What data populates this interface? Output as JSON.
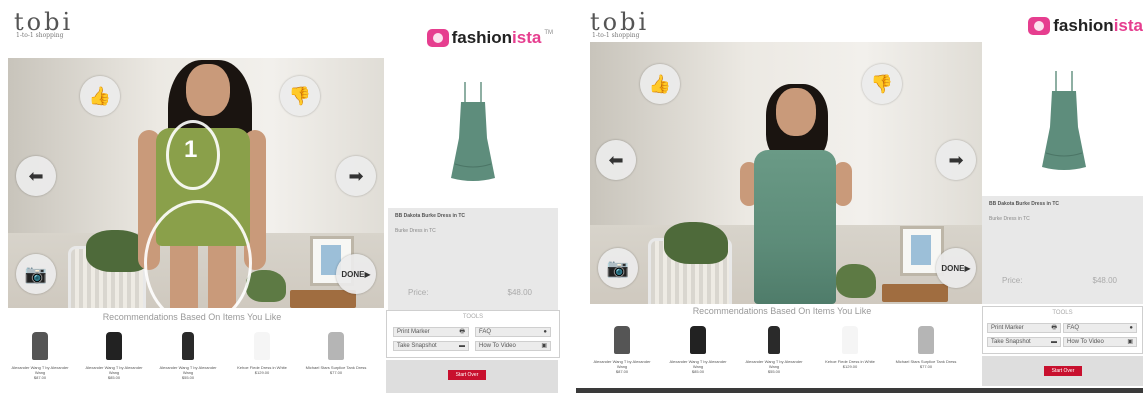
{
  "brand": {
    "name": "tobi",
    "tagline": "1-to-1 shopping"
  },
  "partner": {
    "name_part1": "fashion",
    "name_part2": "ista",
    "tm": "TM",
    "accent": "#e63e8f"
  },
  "video_overlay": {
    "thumbs_up_icon": "thumbs-up-icon",
    "thumbs_down_icon": "thumbs-down-icon",
    "prev_icon": "left-arrow-icon",
    "next_icon": "right-arrow-icon",
    "camera_icon": "camera-icon",
    "done_label": "DONE",
    "gesture_number": "1"
  },
  "product": {
    "name": "BB Dakota Burke Dress in TC",
    "description": "Burke Dress in TC",
    "price_label": "Price:",
    "price": "$48.00",
    "dress_color": "#5e8d7c"
  },
  "recommendations": {
    "title": "Recommendations Based On Items You Like",
    "items": [
      {
        "name": "Alexander Wang T by Alexander Wang",
        "price": "$87.00",
        "color": "#555555"
      },
      {
        "name": "Alexander Wang T by Alexander Wang",
        "price": "$85.00",
        "color": "#222222"
      },
      {
        "name": "Alexander Wang T by Alexander Wang",
        "price": "$55.00",
        "color": "#2a2a2a"
      },
      {
        "name": "Kehoe Fiede Dress in White",
        "price": "$129.00",
        "color": "#f5f5f5"
      },
      {
        "name": "Michael Stars Surplice Tank Dress",
        "price": "$77.00",
        "color": "#b5b5b5"
      }
    ]
  },
  "tools": {
    "title": "TOOLS",
    "print_marker": "Print Marker",
    "faq": "FAQ",
    "take_snapshot": "Take Snapshot",
    "how_to_video": "How To Video"
  },
  "start_over": "Start Over"
}
